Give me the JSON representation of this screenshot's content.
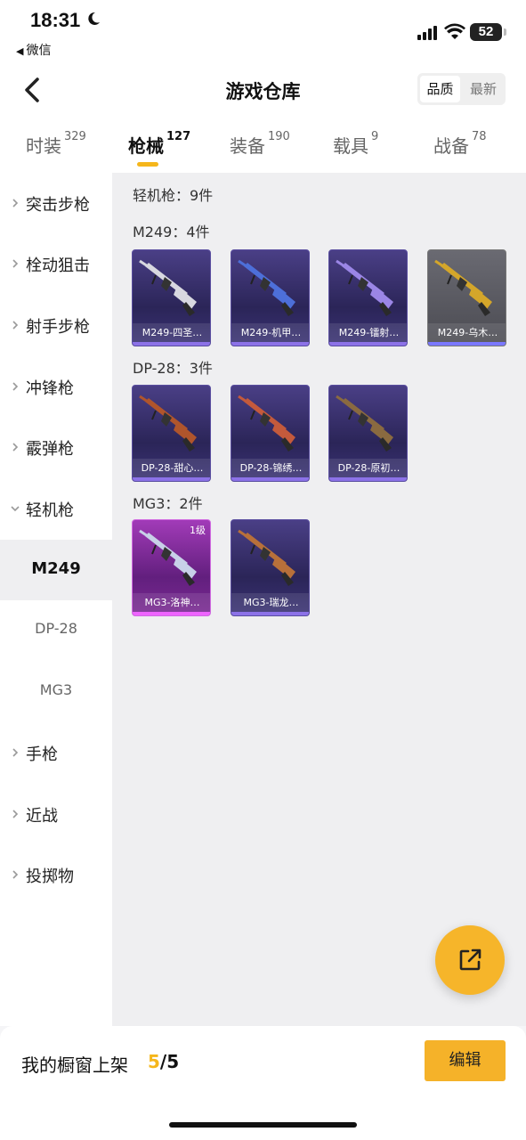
{
  "status_bar": {
    "time": "18:31",
    "back_app": "微信",
    "battery": "52"
  },
  "header": {
    "title": "游戏仓库",
    "sort_quality": "品质",
    "sort_newest": "最新"
  },
  "tabs": [
    {
      "label": "时装",
      "count": "329"
    },
    {
      "label": "枪械",
      "count": "127"
    },
    {
      "label": "装备",
      "count": "190"
    },
    {
      "label": "载具",
      "count": "9"
    },
    {
      "label": "战备",
      "count": "78"
    }
  ],
  "sidebar": {
    "items": [
      {
        "label": "突击步枪"
      },
      {
        "label": "栓动狙击"
      },
      {
        "label": "射手步枪"
      },
      {
        "label": "冲锋枪"
      },
      {
        "label": "霰弹枪"
      },
      {
        "label": "轻机枪"
      },
      {
        "label": "M249"
      },
      {
        "label": "DP-28"
      },
      {
        "label": "MG3"
      },
      {
        "label": "手枪"
      },
      {
        "label": "近战"
      },
      {
        "label": "投掷物"
      }
    ]
  },
  "content": {
    "category_header": "轻机枪：9件",
    "groups": [
      {
        "title": "M249：4件",
        "items": [
          {
            "name": "M249-四圣…",
            "rarity": "purple",
            "gun_color": "#d8d8e0"
          },
          {
            "name": "M249-机甲…",
            "rarity": "purple",
            "gun_color": "#4d6fd9"
          },
          {
            "name": "M249-镭射…",
            "rarity": "purple",
            "gun_color": "#9b86e6"
          },
          {
            "name": "M249-乌木…",
            "rarity": "gray",
            "gun_color": "#d4a62a"
          }
        ]
      },
      {
        "title": "DP-28：3件",
        "items": [
          {
            "name": "DP-28-甜心…",
            "rarity": "purple",
            "gun_color": "#b0552c"
          },
          {
            "name": "DP-28-锦绣…",
            "rarity": "purple",
            "gun_color": "#c45a3c"
          },
          {
            "name": "DP-28-原初…",
            "rarity": "purple",
            "gun_color": "#8a6a40"
          }
        ]
      },
      {
        "title": "MG3：2件",
        "items": [
          {
            "name": "MG3-洛神…",
            "rarity": "pink",
            "level": "1级",
            "gun_color": "#c8d0e8"
          },
          {
            "name": "MG3-瑞龙…",
            "rarity": "purple",
            "gun_color": "#b8703a"
          }
        ]
      }
    ]
  },
  "bottom_bar": {
    "text": "我的橱窗上架",
    "current": "5",
    "total": "/5",
    "edit_label": "编辑"
  }
}
